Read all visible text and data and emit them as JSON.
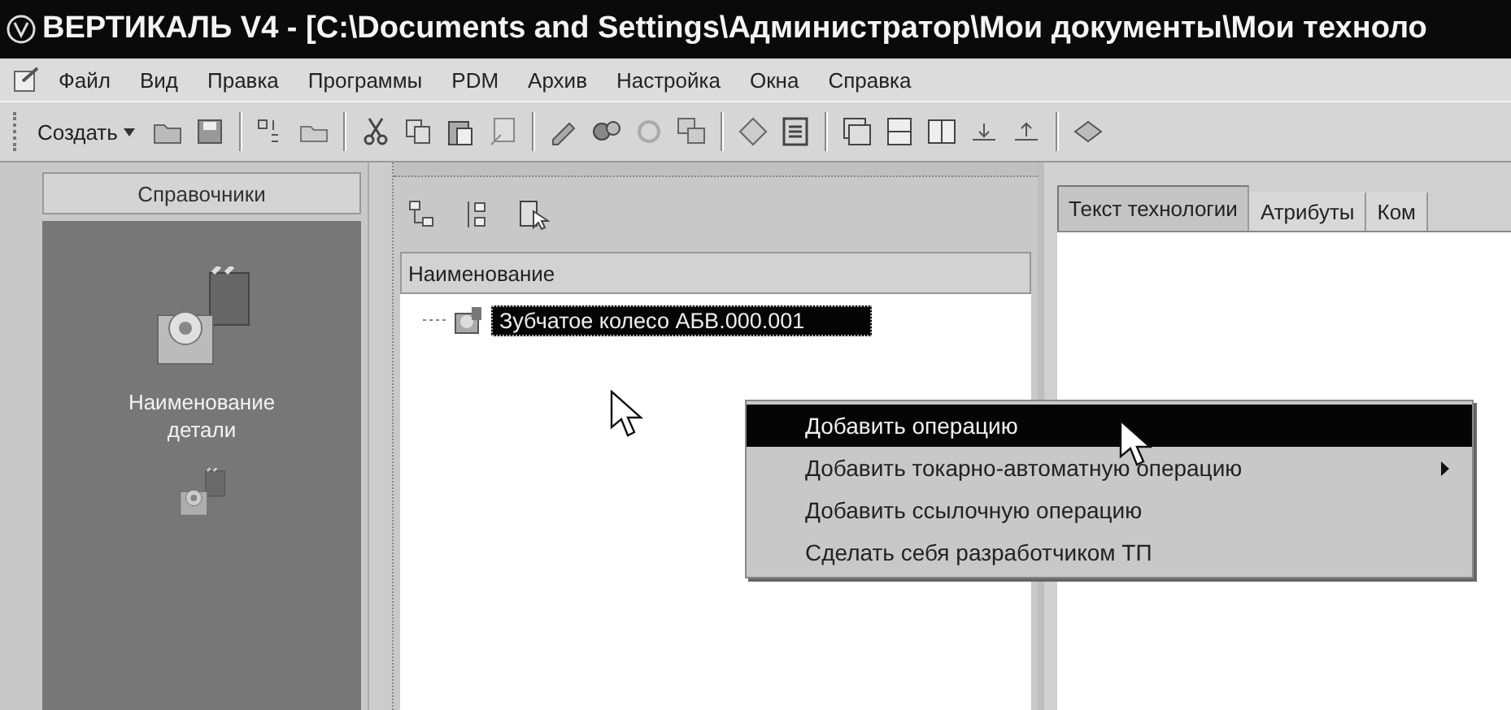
{
  "window": {
    "title": "ВЕРТИКАЛЬ V4 - [C:\\Documents and Settings\\Администратор\\Мои документы\\Мои техноло"
  },
  "menu": [
    "Файл",
    "Вид",
    "Правка",
    "Программы",
    "PDM",
    "Архив",
    "Настройка",
    "Окна",
    "Справка"
  ],
  "toolbar": {
    "create_button": "Создать"
  },
  "sidebar": {
    "header": "Справочники",
    "items": [
      {
        "label": "Наименование детали",
        "selected": true
      },
      {
        "selected": false
      }
    ]
  },
  "tree": {
    "column": "Наименование",
    "items": [
      {
        "label": "Зубчатое колесо АБВ.000.001",
        "selected": true
      }
    ]
  },
  "tabs": [
    {
      "label": "Текст технологии",
      "selected": true
    },
    {
      "label": "Атрибуты",
      "selected": false
    },
    {
      "label": "Ком",
      "selected": false
    }
  ],
  "context_menu": [
    {
      "label": "Добавить операцию",
      "selected": true,
      "submenu": false
    },
    {
      "label": "Добавить токарно-автоматную операцию",
      "selected": false,
      "submenu": true
    },
    {
      "label": "Добавить ссылочную операцию",
      "selected": false,
      "submenu": false
    },
    {
      "label": "Сделать себя разработчиком ТП",
      "selected": false,
      "submenu": false
    }
  ]
}
